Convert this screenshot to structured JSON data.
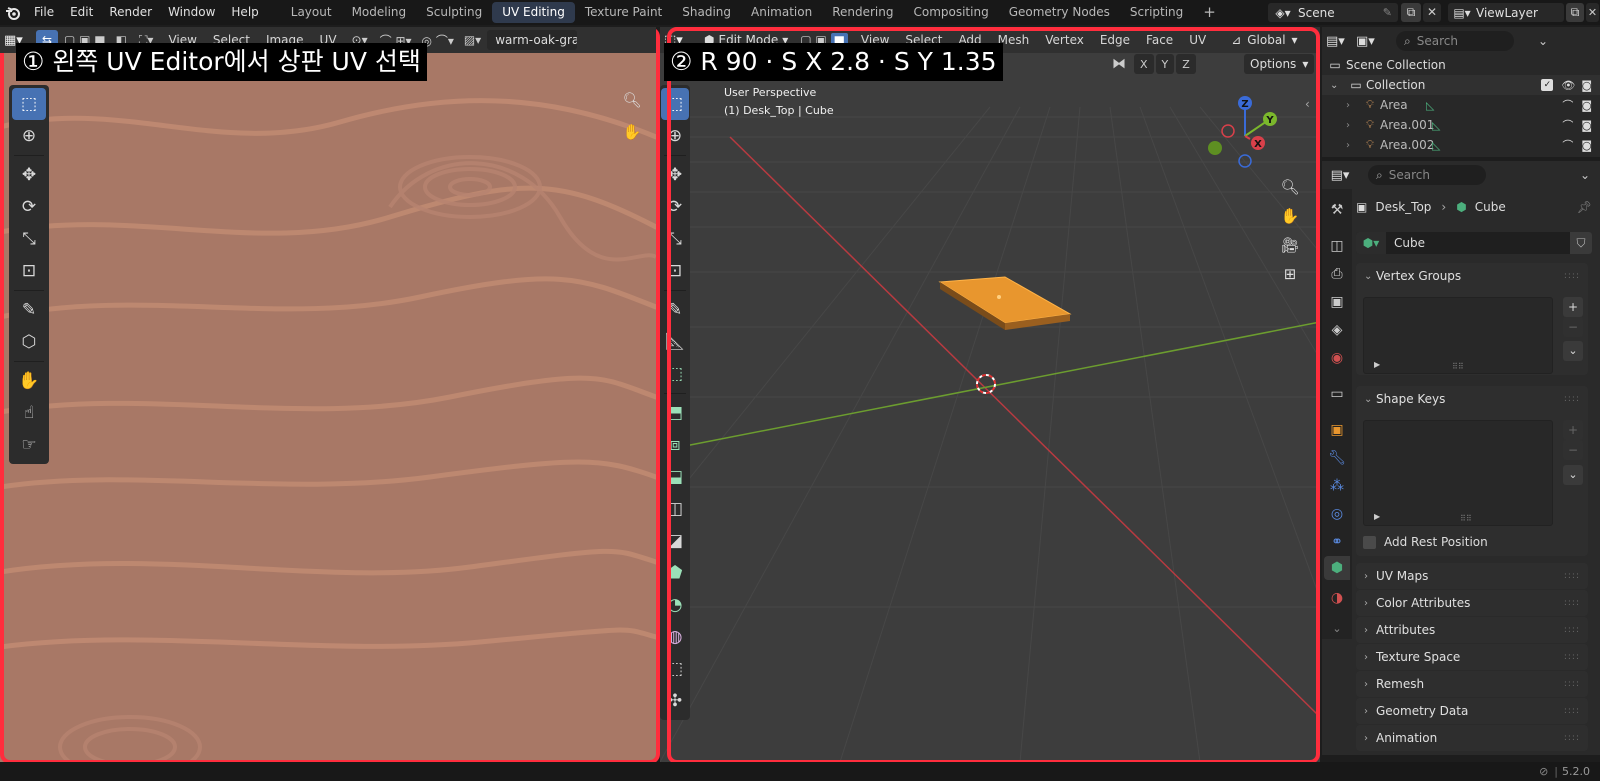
{
  "topbar": {
    "menus": [
      "File",
      "Edit",
      "Render",
      "Window",
      "Help"
    ],
    "workspaces": [
      "Layout",
      "Modeling",
      "Sculpting",
      "UV Editing",
      "Texture Paint",
      "Shading",
      "Animation",
      "Rendering",
      "Compositing",
      "Geometry Nodes",
      "Scripting"
    ],
    "active_workspace": "UV Editing",
    "add_workspace": "+",
    "scene": "Scene",
    "view_layer": "ViewLayer"
  },
  "uv_editor": {
    "menus": [
      "View",
      "Select",
      "Image",
      "UV"
    ],
    "image_name": "warm-oak-gra",
    "texture_color": "#a87866",
    "caption": "① 왼쪽 UV Editor에서 상판 UV 선택"
  },
  "viewport": {
    "mode": "Edit Mode",
    "menus": [
      "View",
      "Select",
      "Add",
      "Mesh",
      "Vertex",
      "Edge",
      "Face",
      "UV"
    ],
    "transform_orientation": "Global",
    "axes": [
      "X",
      "Y",
      "Z"
    ],
    "options_label": "Options",
    "overlay_title": "User Perspective",
    "overlay_object": "(1) Desk_Top | Cube",
    "caption": "② R 90 · S X 2.8 · S Y 1.35",
    "gizmo": {
      "x": "X",
      "y": "Y",
      "z": "Z"
    }
  },
  "outliner": {
    "search_placeholder": "Search",
    "scene_collection": "Scene Collection",
    "collection": "Collection",
    "items": [
      "Area",
      "Area.001",
      "Area.002"
    ]
  },
  "properties": {
    "search_placeholder": "Search",
    "breadcrumb_object": "Desk_Top",
    "breadcrumb_data": "Cube",
    "mesh_name": "Cube",
    "vertex_groups": "Vertex Groups",
    "shape_keys": "Shape Keys",
    "add_rest_position": "Add Rest Position",
    "collapsed_panels": [
      "UV Maps",
      "Color Attributes",
      "Attributes",
      "Texture Space",
      "Remesh",
      "Geometry Data",
      "Animation"
    ]
  },
  "statusbar": {
    "version": "5.2.0"
  },
  "colors": {
    "accent": "#4772b3",
    "highlight_frame": "#ff2d3d",
    "selected_mesh": "#e8962e"
  }
}
